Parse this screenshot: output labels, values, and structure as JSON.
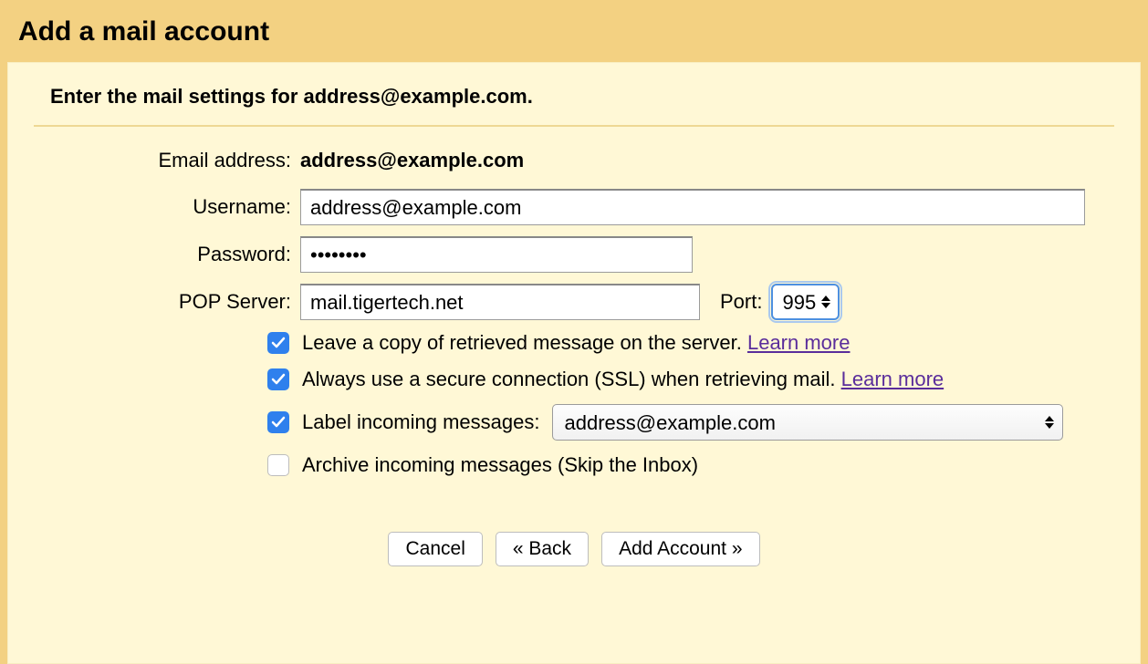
{
  "title": "Add a mail account",
  "subtitle": "Enter the mail settings for address@example.com.",
  "form": {
    "email_label": "Email address:",
    "email_value": "address@example.com",
    "username_label": "Username:",
    "username_value": "address@example.com",
    "password_label": "Password:",
    "password_value": "••••••••",
    "pop_label": "POP Server:",
    "pop_value": "mail.tigertech.net",
    "port_label": "Port:",
    "port_value": "995"
  },
  "options": {
    "leave_copy": {
      "checked": true,
      "label": "Leave a copy of retrieved message on the server.",
      "learn": "Learn more"
    },
    "ssl": {
      "checked": true,
      "label": "Always use a secure connection (SSL) when retrieving mail.",
      "learn": "Learn more"
    },
    "label_incoming": {
      "checked": true,
      "label": "Label incoming messages:",
      "selected": "address@example.com"
    },
    "archive": {
      "checked": false,
      "label": "Archive incoming messages (Skip the Inbox)"
    }
  },
  "buttons": {
    "cancel": "Cancel",
    "back": "« Back",
    "add": "Add Account »"
  }
}
